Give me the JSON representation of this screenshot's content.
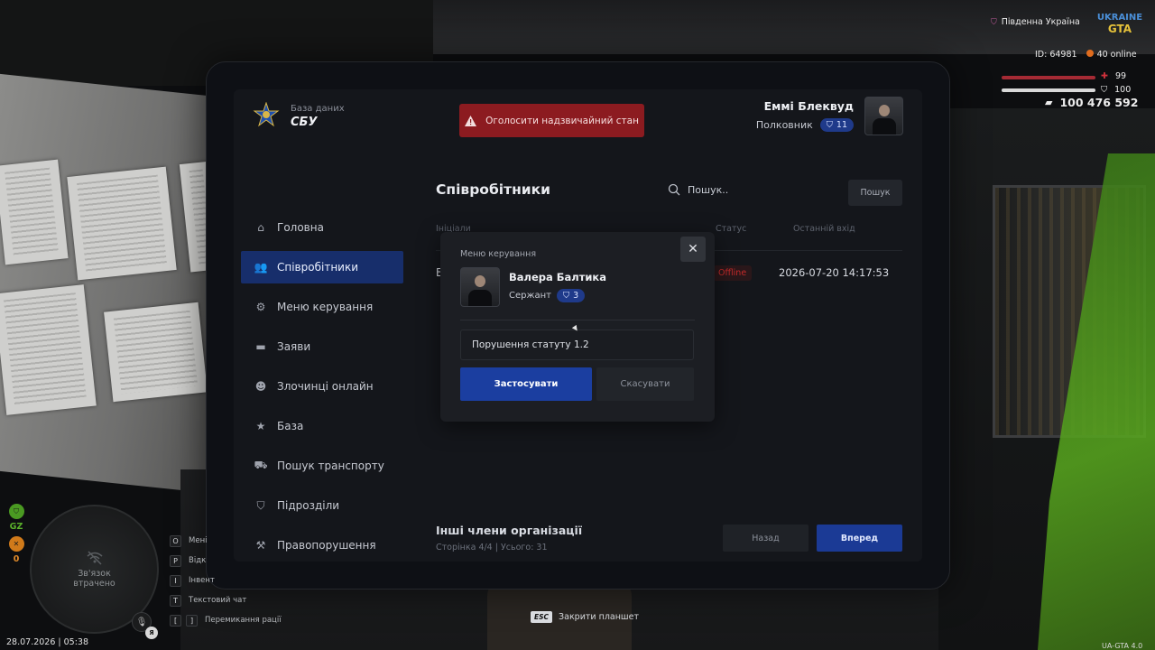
{
  "hud": {
    "server": "Південна Україна",
    "game_logo_top": "UKRAINE",
    "game_logo_bottom": "GTA",
    "player_id": "ID: 64981",
    "online": "40 online",
    "health": "99",
    "armor": "100",
    "money": "100 476 592",
    "side_label": "GZ",
    "side_count": "0",
    "minimap_status": "Зв'язок втрачено",
    "datetime": "28.07.2026 | 05:38",
    "version": "UA-GTA 4.0",
    "mic_badge": "Я",
    "keys": [
      {
        "key": "O",
        "label": "Мені"
      },
      {
        "key": "P",
        "label": "Відк"
      },
      {
        "key": "I",
        "label": "Інвент"
      },
      {
        "key": "T",
        "label": "Текстовий чат"
      },
      {
        "key1": "[",
        "key2": "]",
        "label": "Перемикання рації"
      }
    ],
    "esc_key": "ESC",
    "esc_label": "Закрити планшет",
    "colors": {
      "health": "#a52a34",
      "online_dot": "#e06c1e",
      "side_green": "#4a9a22",
      "side_orange": "#d07a1a"
    }
  },
  "tablet": {
    "db_title": "База даних",
    "db_name": "СБУ",
    "emergency_label": "Оголосити надзвичайний стан",
    "user": {
      "name": "Еммі Блеквуд",
      "rank": "Полковник",
      "rank_level": "11"
    },
    "nav": [
      {
        "label": "Головна",
        "icon": "home-icon"
      },
      {
        "label": "Співробітники",
        "icon": "users-icon",
        "active": true
      },
      {
        "label": "Меню керування",
        "icon": "gear-icon"
      },
      {
        "label": "Заяви",
        "icon": "folder-icon"
      },
      {
        "label": "Злочинці онлайн",
        "icon": "criminal-icon"
      },
      {
        "label": "База",
        "icon": "star-icon"
      },
      {
        "label": "Пошук транспорту",
        "icon": "car-icon"
      },
      {
        "label": "Підрозділи",
        "icon": "shield-icon"
      },
      {
        "label": "Правопорушення",
        "icon": "gavel-icon"
      }
    ],
    "staff": {
      "title": "Співробітники",
      "search_placeholder": "Пошук..",
      "search_button": "Пошук",
      "columns": {
        "initials": "Ініціали",
        "status": "Статус",
        "last_login": "Останній вхід"
      },
      "row": {
        "name_initial": "В",
        "status": "Offline",
        "last_login": "2026-07-20 14:17:53"
      },
      "others_title": "Інші члени організації",
      "page_info": "Сторінка 4/4 | Усього: 31",
      "prev": "Назад",
      "next": "Вперед"
    },
    "modal": {
      "title": "Меню керування",
      "name": "Валера Балтика",
      "rank": "Сержант",
      "rank_level": "3",
      "reason_value": "Порушення статуту 1.2",
      "apply": "Застосувати",
      "cancel": "Скасувати"
    },
    "colors": {
      "accent": "#1b3ea0",
      "emergency": "#8c1b20",
      "active_nav": "#172e6b",
      "offline": "#c62a2a"
    }
  }
}
